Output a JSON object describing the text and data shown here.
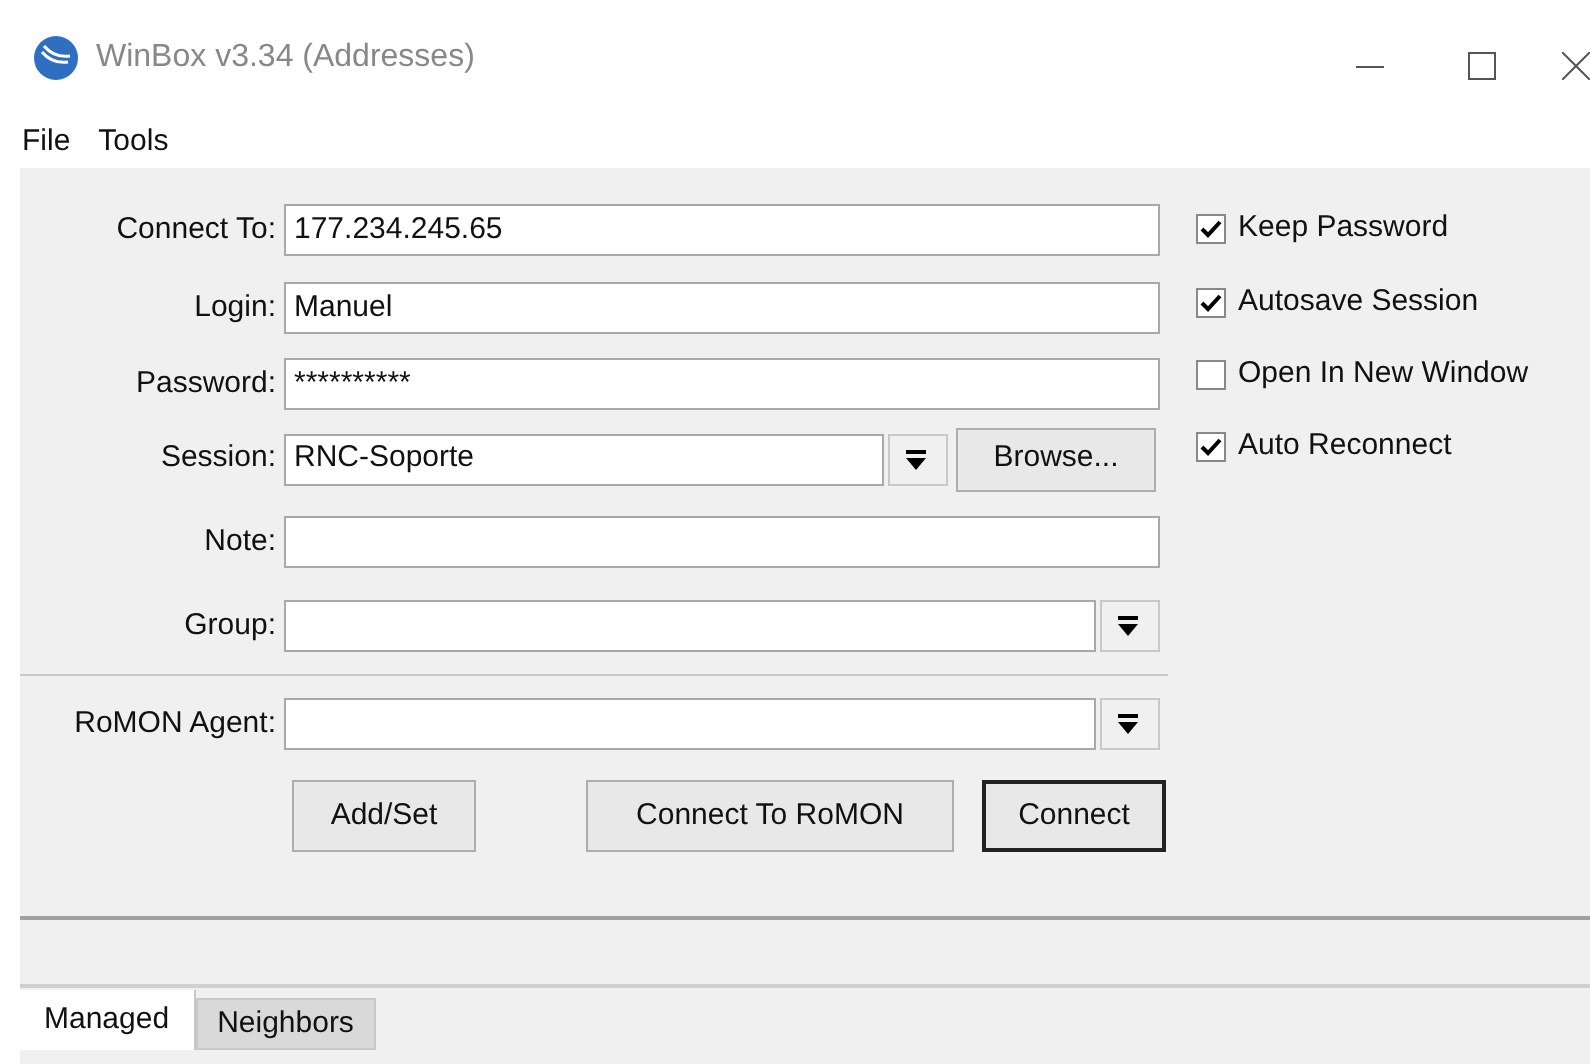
{
  "window": {
    "title": "WinBox v3.34 (Addresses)"
  },
  "menu": [
    "File",
    "Tools"
  ],
  "fields": [
    {
      "label": "Connect To:",
      "kind": "text",
      "value": "177.234.245.65"
    },
    {
      "label": "Login:",
      "kind": "text",
      "value": "Manuel"
    },
    {
      "label": "Password:",
      "kind": "text",
      "value": "**********"
    },
    {
      "label": "Session:",
      "kind": "session",
      "value": "RNC-Soporte",
      "button": "Browse..."
    },
    {
      "label": "Note:",
      "kind": "text"
    },
    {
      "label": "Group:",
      "kind": "dropdown"
    },
    {
      "label": "RoMON Agent:",
      "kind": "dropdown",
      "separated": true
    }
  ],
  "options": [
    {
      "label": "Keep Password",
      "checked": true
    },
    {
      "label": "Autosave Session",
      "checked": true
    },
    {
      "label": "Open In New Window",
      "checked": false
    },
    {
      "label": "Auto Reconnect",
      "checked": true
    }
  ],
  "buttons": [
    {
      "label": "Add/Set",
      "default": false
    },
    {
      "label": "Connect To RoMON",
      "default": false
    },
    {
      "label": "Connect",
      "default": true
    }
  ],
  "tabs": [
    {
      "label": "Managed",
      "selected": true
    },
    {
      "label": "Neighbors",
      "selected": false
    }
  ]
}
